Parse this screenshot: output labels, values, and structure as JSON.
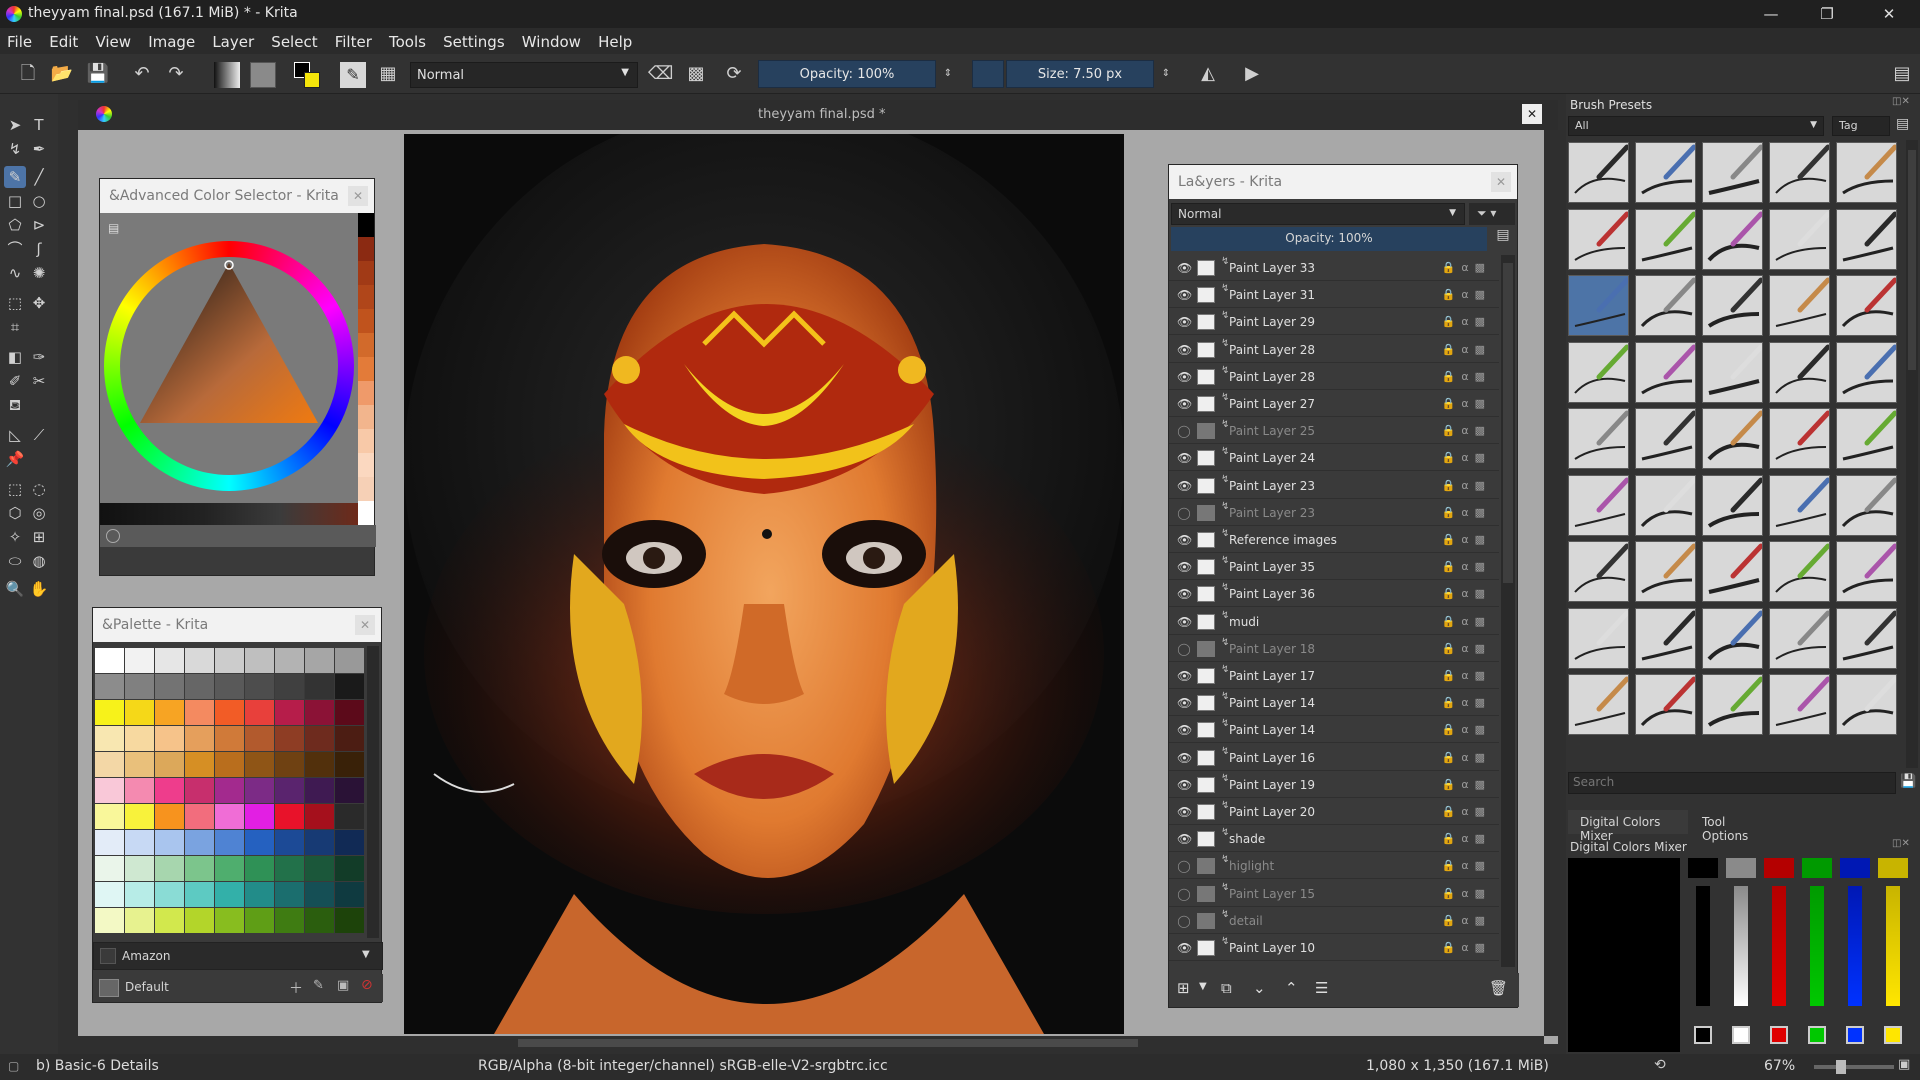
{
  "window": {
    "title": "theyyam final.psd (167.1 MiB)  * - Krita",
    "controls": [
      "—",
      "❐",
      "✕"
    ]
  },
  "menu": [
    "File",
    "Edit",
    "View",
    "Image",
    "Layer",
    "Select",
    "Filter",
    "Tools",
    "Settings",
    "Window",
    "Help"
  ],
  "toolbar": {
    "blend_mode": "Normal",
    "opacity": "Opacity: 100%",
    "size": "Size: 7.50 px"
  },
  "document": {
    "tab_title": "theyyam final.psd *"
  },
  "color_selector": {
    "title": "&Advanced Color Selector - Krita",
    "history_colors": [
      "#000000",
      "#8b2a12",
      "#a13a16",
      "#b0461a",
      "#c0531d",
      "#d26a2b",
      "#e37b39",
      "#ef9a6a",
      "#f2b58d",
      "#f8c9a8",
      "#fbd8c0",
      "#f6d0b6",
      "#ffffff"
    ]
  },
  "palette": {
    "title": "&Palette - Krita",
    "name_field": "Amazon",
    "default_label": "Default",
    "rows": [
      [
        "#ffffff",
        "#f2f2f2",
        "#e6e6e6",
        "#d9d9d9",
        "#cccccc",
        "#bfbfbf",
        "#b3b3b3",
        "#a6a6a6",
        "#999999"
      ],
      [
        "#8c8c8c",
        "#808080",
        "#737373",
        "#666666",
        "#595959",
        "#4d4d4d",
        "#404040",
        "#333333",
        "#1a1a1a"
      ],
      [
        "#f7f21a",
        "#f5d818",
        "#f7a423",
        "#f48a60",
        "#f25c26",
        "#e8403b",
        "#b61d4a",
        "#8b1236",
        "#5c0a1a"
      ],
      [
        "#f8e7b1",
        "#f7d9a0",
        "#f6c38a",
        "#e59f5c",
        "#d07a39",
        "#b25a2d",
        "#8e3d24",
        "#6e2b1e",
        "#4c1d13"
      ],
      [
        "#f3d7a6",
        "#e9c07b",
        "#dca85a",
        "#d68f24",
        "#b96e1d",
        "#8f5516",
        "#6f4112",
        "#52300c",
        "#392108"
      ],
      [
        "#f9c8d8",
        "#f48ab0",
        "#ee3d8c",
        "#c72f6d",
        "#a32a8e",
        "#7c2b86",
        "#5a246e",
        "#3f1a52",
        "#2a1236"
      ],
      [
        "#f9f79a",
        "#f8f23b",
        "#f7931e",
        "#f26d7d",
        "#f06dd6",
        "#e21fe3",
        "#e8122a",
        "#a5101c",
        "#2a2a2a"
      ],
      [
        "#e3ecf8",
        "#c7d9f4",
        "#a9c5ee",
        "#7aa3e0",
        "#4f83d3",
        "#2561c0",
        "#1c4a96",
        "#173a74",
        "#112a55"
      ],
      [
        "#eaf5ea",
        "#cfe8d1",
        "#a7d6ae",
        "#7cc58c",
        "#4fae6e",
        "#2f9156",
        "#22714a",
        "#1b573a",
        "#123c28"
      ],
      [
        "#dff6f4",
        "#b7ece7",
        "#8adcd5",
        "#5dcac2",
        "#33b0a9",
        "#228c89",
        "#1b6e6e",
        "#154f55",
        "#0f3a40"
      ],
      [
        "#f3f9c5",
        "#e7f28f",
        "#d2e84d",
        "#b3d52a",
        "#88bd1f",
        "#5f9e16",
        "#3f7c12",
        "#2b5e0e",
        "#1d430a"
      ]
    ]
  },
  "layers": {
    "title": "La&yers - Krita",
    "blend_mode": "Normal",
    "opacity": "Opacity:  100%",
    "items": [
      {
        "name": "Paint Layer 33",
        "visible": true
      },
      {
        "name": "Paint Layer 31",
        "visible": true
      },
      {
        "name": "Paint Layer 29",
        "visible": true
      },
      {
        "name": "Paint Layer 28",
        "visible": true
      },
      {
        "name": "Paint Layer 28",
        "visible": true
      },
      {
        "name": "Paint Layer 27",
        "visible": true
      },
      {
        "name": "Paint Layer 25",
        "visible": false
      },
      {
        "name": "Paint Layer 24",
        "visible": true
      },
      {
        "name": "Paint Layer 23",
        "visible": true
      },
      {
        "name": "Paint Layer 23",
        "visible": false
      },
      {
        "name": "Reference images",
        "visible": true
      },
      {
        "name": "Paint Layer 35",
        "visible": true
      },
      {
        "name": "Paint Layer 36",
        "visible": true
      },
      {
        "name": "mudi",
        "visible": true
      },
      {
        "name": "Paint Layer 18",
        "visible": false
      },
      {
        "name": "Paint Layer 17",
        "visible": true
      },
      {
        "name": "Paint Layer 14",
        "visible": true
      },
      {
        "name": "Paint Layer 14",
        "visible": true
      },
      {
        "name": "Paint Layer 16",
        "visible": true
      },
      {
        "name": "Paint Layer 19",
        "visible": true
      },
      {
        "name": "Paint Layer 20",
        "visible": true
      },
      {
        "name": "shade",
        "visible": true
      },
      {
        "name": "higlight",
        "visible": false
      },
      {
        "name": "Paint Layer 15",
        "visible": false
      },
      {
        "name": "detail",
        "visible": false
      },
      {
        "name": "Paint Layer 10",
        "visible": true
      }
    ]
  },
  "brush_presets": {
    "title": "Brush Presets",
    "filter": "All",
    "tag": "Tag",
    "search_placeholder": "Search",
    "count_rows": 9,
    "count_cols": 5
  },
  "mixer": {
    "tab_active": "Digital Colors Mixer",
    "tab_other": "Tool Options",
    "title": "Digital Colors Mixer",
    "top_colors": [
      "#000000",
      "#8a8a8a",
      "#b40000",
      "#009a00",
      "#0018b4",
      "#c8b400"
    ],
    "bottom_colors": [
      "#000000",
      "#ffffff",
      "#e00000",
      "#00c800",
      "#0032ff",
      "#ffe600"
    ]
  },
  "status": {
    "left": "b) Basic-6 Details",
    "color_space": "RGB/Alpha (8-bit integer/channel)  sRGB-elle-V2-srgbtrc.icc",
    "size": "1,080 x 1,350 (167.1 MiB)",
    "zoom": "67%"
  }
}
